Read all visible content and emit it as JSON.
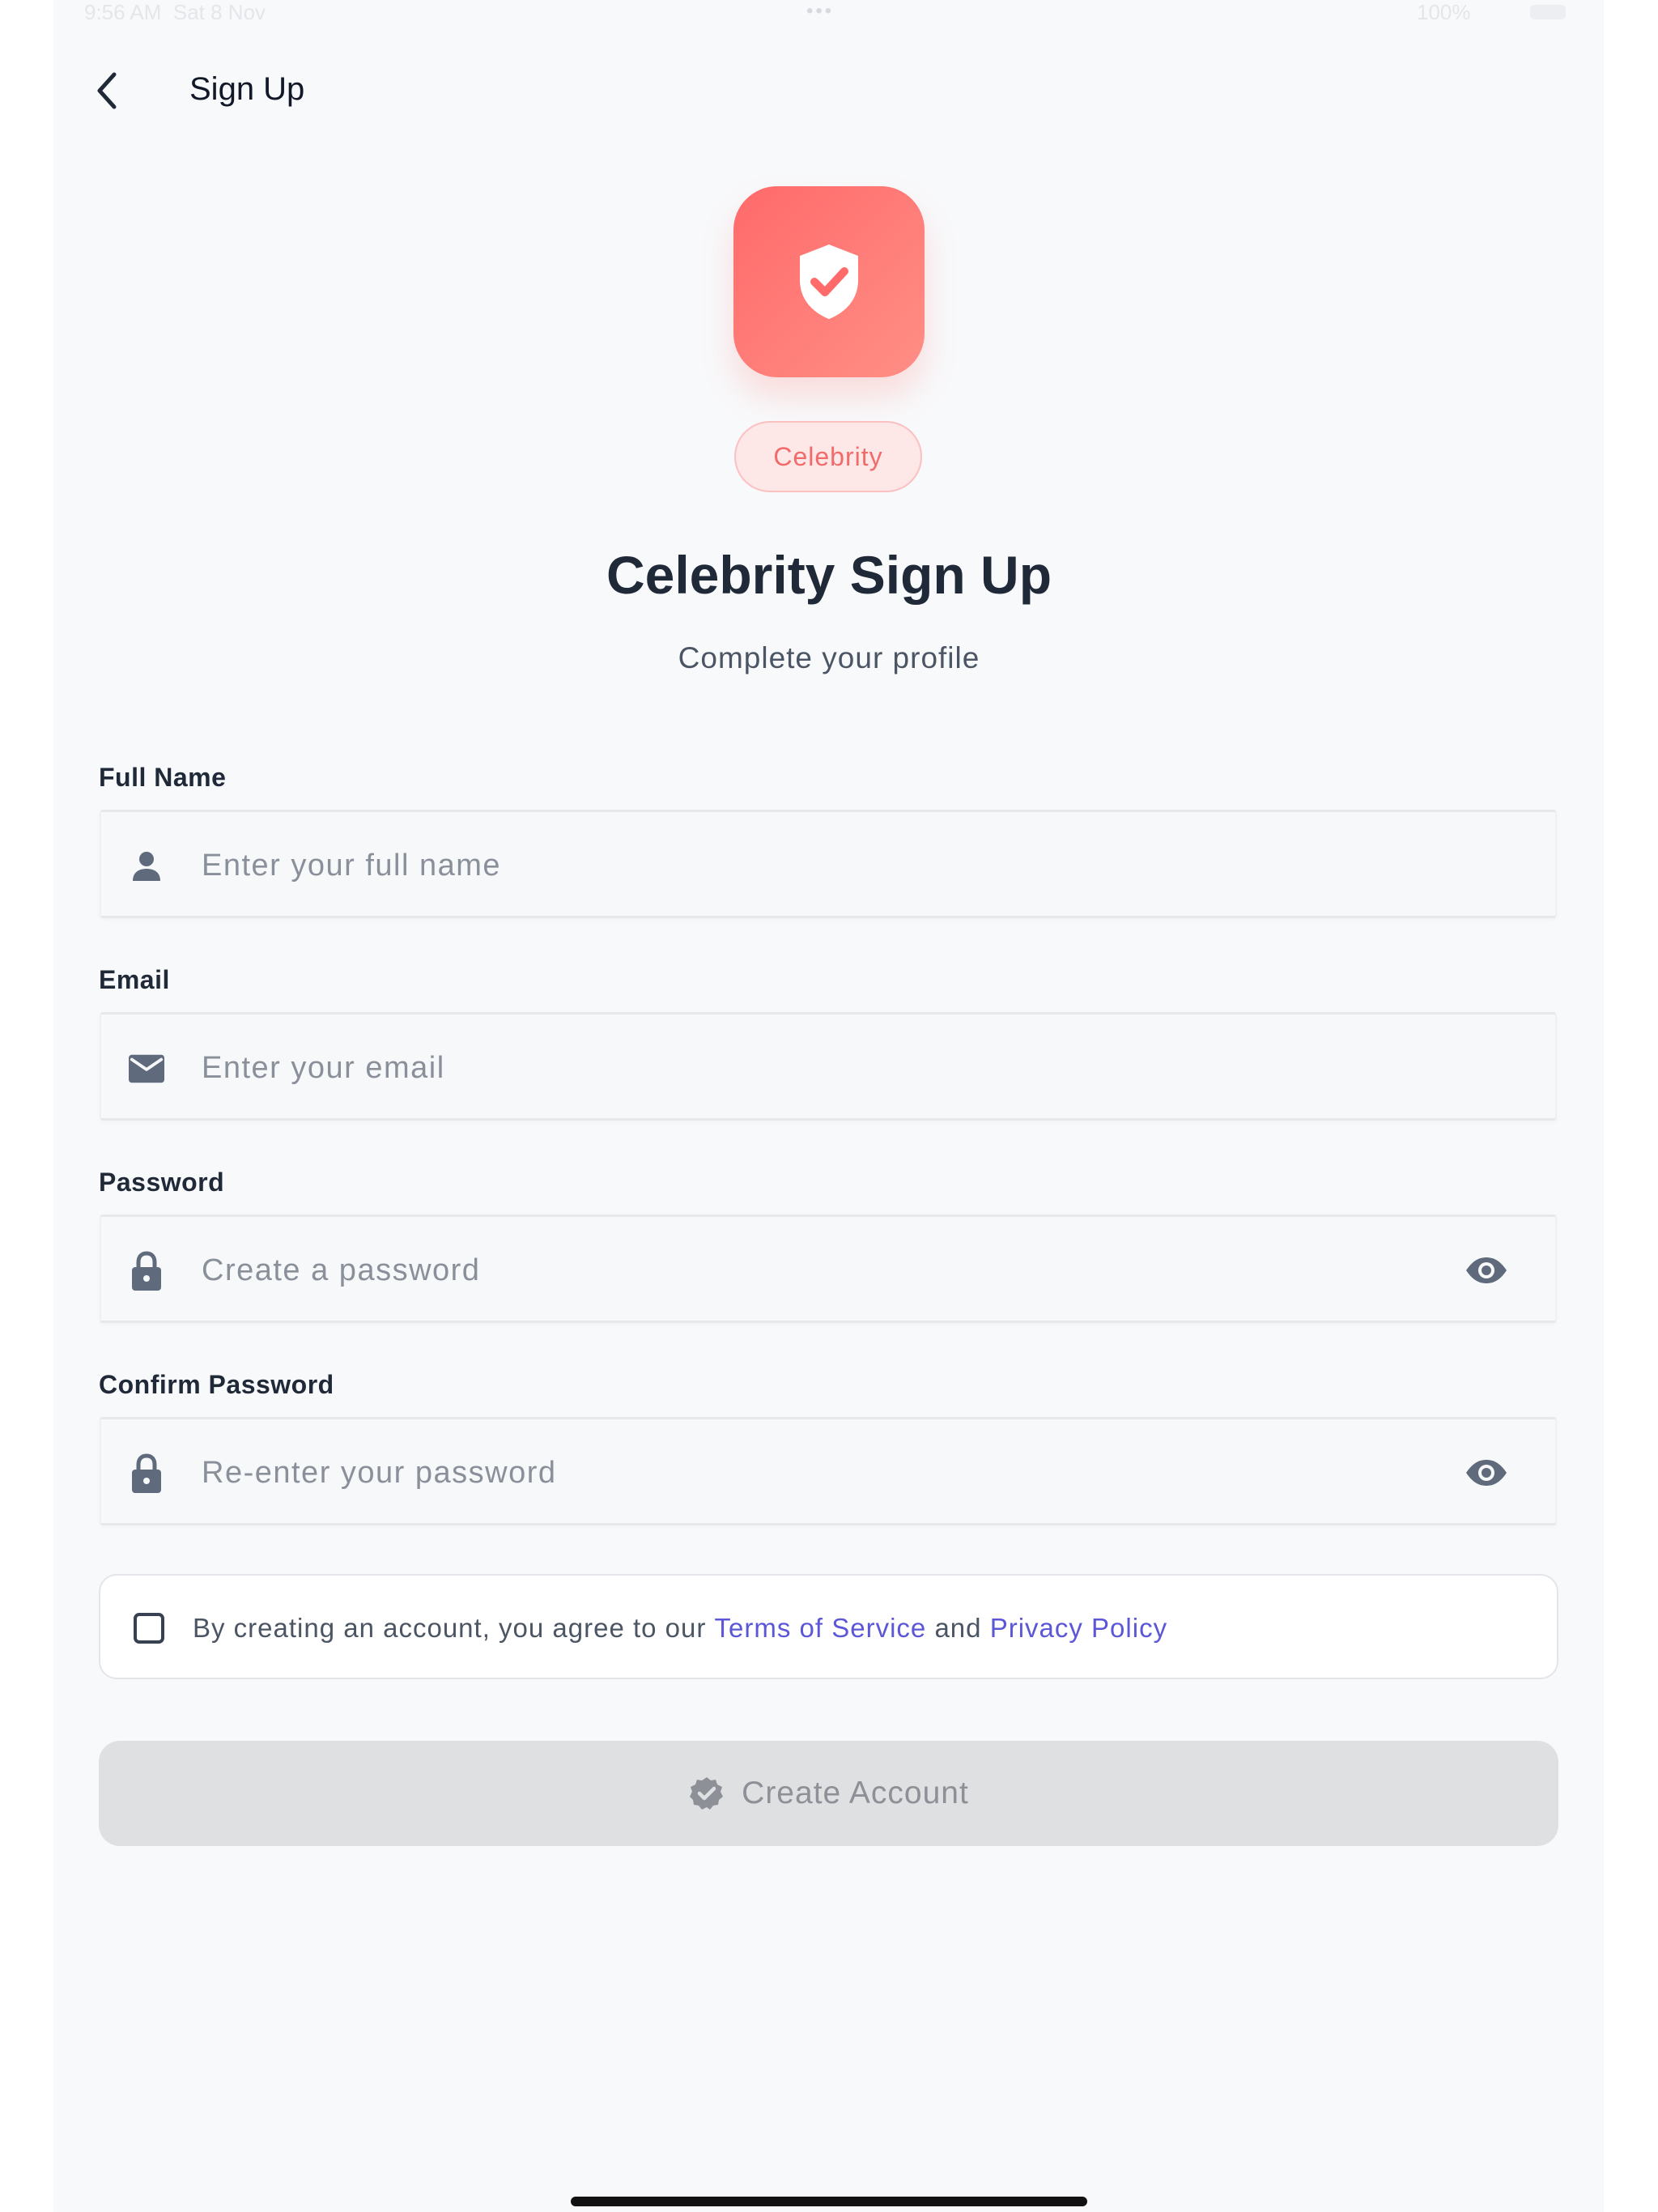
{
  "status_bar": {
    "time": "9:56 AM",
    "date": "Sat 8 Nov",
    "dots": "•••",
    "battery": "100%"
  },
  "header": {
    "back_icon": "chevron-left-icon",
    "title": "Sign Up"
  },
  "hero": {
    "logo_icon": "shield-check-icon",
    "badge": "Celebrity",
    "title": "Celebrity Sign Up",
    "subtitle": "Complete your profile"
  },
  "form": {
    "full_name": {
      "label": "Full Name",
      "placeholder": "Enter your full name",
      "value": "",
      "icon": "person-icon"
    },
    "email": {
      "label": "Email",
      "placeholder": "Enter your email",
      "value": "",
      "icon": "envelope-icon"
    },
    "password": {
      "label": "Password",
      "placeholder": "Create a password",
      "value": "",
      "icon": "lock-icon",
      "toggle_icon": "eye-icon"
    },
    "confirm_password": {
      "label": "Confirm Password",
      "placeholder": "Re-enter your password",
      "value": "",
      "icon": "lock-icon",
      "toggle_icon": "eye-icon"
    }
  },
  "terms": {
    "checked": false,
    "prefix": "By creating an account, you agree to our ",
    "terms_link": "Terms of Service",
    "conjunction": " and ",
    "privacy_link": "Privacy Policy"
  },
  "submit": {
    "label": "Create Account",
    "icon": "verified-badge-icon",
    "enabled": false
  },
  "colors": {
    "accent": "#ff6f6f",
    "link": "#5b57d6",
    "title": "#1f2937",
    "disabled_button": "#dfe0e2"
  }
}
